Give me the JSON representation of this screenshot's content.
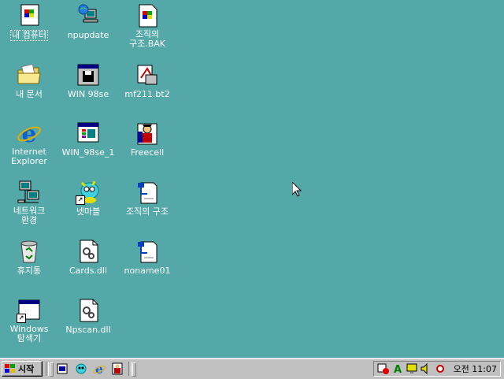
{
  "desktop": {
    "icons": [
      {
        "label": "내 컴퓨터",
        "icon": "my-computer-icon"
      },
      {
        "label": "npupdate",
        "icon": "network-update-icon"
      },
      {
        "label": "조직의\n구조.BAK",
        "icon": "document-icon"
      },
      {
        "label": "내 문서",
        "icon": "folder-icon"
      },
      {
        "label": "WIN 98se",
        "icon": "floppy-window-icon"
      },
      {
        "label": "mf211.bt2",
        "icon": "unknown-file-icon"
      },
      {
        "label": "Internet\nExplorer",
        "icon": "internet-explorer-icon"
      },
      {
        "label": "WIN_98se_1",
        "icon": "program-window-icon"
      },
      {
        "label": "Freecell",
        "icon": "freecell-icon"
      },
      {
        "label": "네트워크\n환경",
        "icon": "network-neighborhood-icon"
      },
      {
        "label": "넷마블",
        "icon": "netmarble-icon"
      },
      {
        "label": "조직의 구조",
        "icon": "org-chart-document-icon"
      },
      {
        "label": "휴지통",
        "icon": "recycle-bin-icon"
      },
      {
        "label": "Cards.dll",
        "icon": "dll-file-icon"
      },
      {
        "label": "noname01",
        "icon": "org-chart-document-icon"
      },
      {
        "label": "Windows\n탐색기",
        "icon": "windows-explorer-icon"
      },
      {
        "label": "Npscan.dll",
        "icon": "dll-file-icon"
      }
    ]
  },
  "taskbar": {
    "start_label": "시작",
    "quick_launch": [
      "show-desktop-icon",
      "netmarble-quick-icon",
      "internet-explorer-quick-icon",
      "freecell-quick-icon"
    ],
    "tray_icons": [
      "scheduler-icon",
      "language-bar-icon",
      "display-icon",
      "volume-icon",
      "ime-icon"
    ],
    "clock": "오전 11:07"
  },
  "colors": {
    "desktop_background": "#54a8a8",
    "taskbar": "#c0c0c0"
  }
}
